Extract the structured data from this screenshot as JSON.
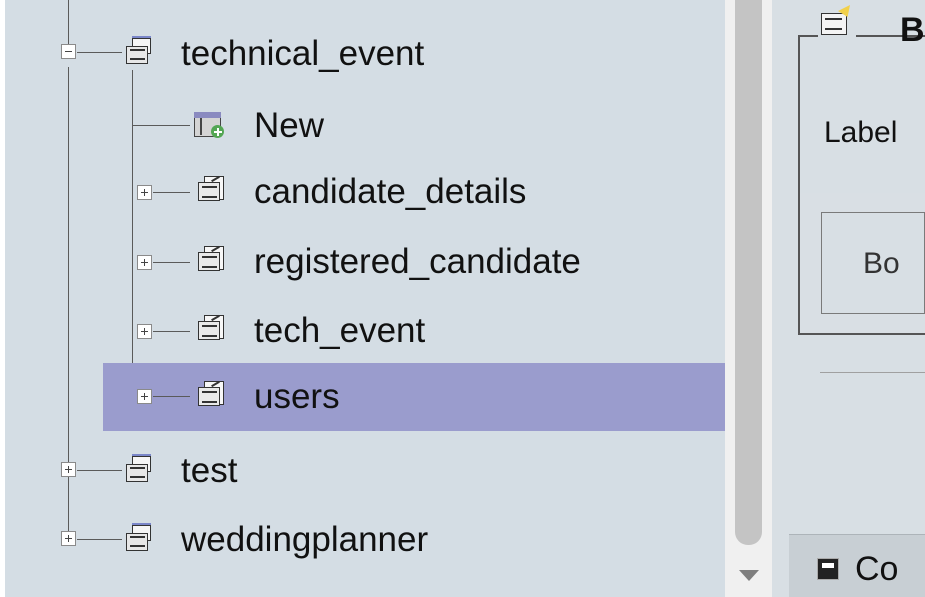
{
  "tree": {
    "root_label": "technical_event",
    "children": [
      {
        "label": "New"
      },
      {
        "label": "candidate_details"
      },
      {
        "label": "registered_candidate"
      },
      {
        "label": "tech_event"
      },
      {
        "label": "users"
      }
    ],
    "siblings": [
      {
        "label": "test"
      },
      {
        "label": "weddingplanner"
      }
    ]
  },
  "right_panel": {
    "group_title": "B",
    "label_text": "Label",
    "field_text": "Bo",
    "footer_text": "Co"
  },
  "colors": {
    "tree_background": "#d4dde4",
    "selection": "#9a9ccd",
    "panel_background": "#d8dfe4"
  },
  "icons": {
    "database": "database-icon",
    "table": "table-icon",
    "new_table": "new-table-icon",
    "expand": "expand-toggle-icon",
    "collapse": "collapse-toggle-icon"
  }
}
